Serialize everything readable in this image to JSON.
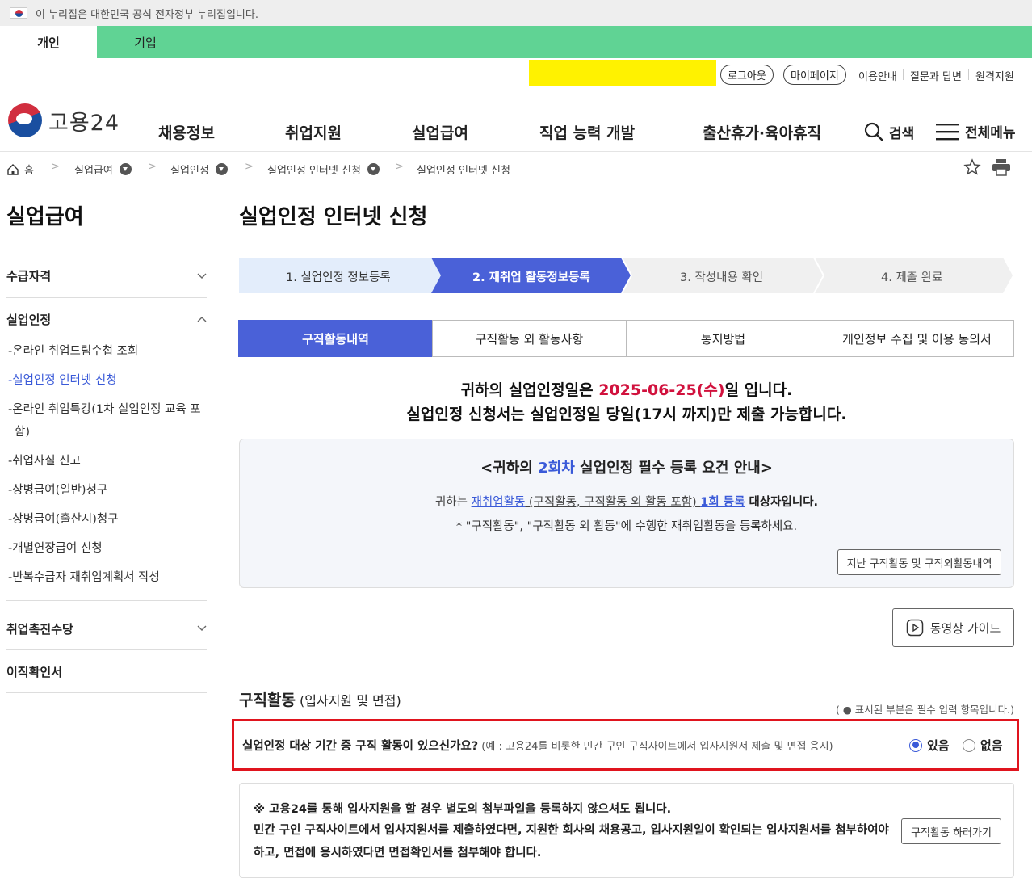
{
  "gov_banner": "이 누리집은 대한민국 공식 전자정부 누리집입니다.",
  "top_tabs": [
    "개인",
    "기업"
  ],
  "utility": {
    "logout": "로그아웃",
    "mypage": "마이페이지",
    "links": [
      "이용안내",
      "질문과 답변",
      "원격지원"
    ]
  },
  "logo_text": "고용24",
  "gnb": [
    "채용정보",
    "취업지원",
    "실업급여",
    "직업 능력 개발",
    "출산휴가·육아휴직"
  ],
  "search_label": "검색",
  "all_menu_label": "전체메뉴",
  "breadcrumb": [
    "홈",
    "실업급여",
    "실업인정",
    "실업인정 인터넷 신청",
    "실업인정 인터넷 신청"
  ],
  "lnb": {
    "title": "실업급여",
    "sections": [
      "수급자격",
      "실업인정",
      "취업촉진수당",
      "이직확인서"
    ],
    "sub_items": [
      "온라인 취업드림수첩 조회",
      "실업인정 인터넷 신청",
      "온라인 취업특강(1차 실업인정 교육 포함)",
      "취업사실 신고",
      "상병급여(일반)청구",
      "상병급여(출산시)청구",
      "개별연장급여 신청",
      "반복수급자 재취업계획서 작성"
    ]
  },
  "page_title": "실업인정 인터넷 신청",
  "steps": [
    "1. 실업인정 정보등록",
    "2. 재취업 활동정보등록",
    "3. 작성내용 확인",
    "4. 제출 완료"
  ],
  "content_tabs": [
    "구직활동내역",
    "구직활동 외 활동사항",
    "통지방법",
    "개인정보 수집 및 이용 동의서"
  ],
  "notice": {
    "line1_pre": "귀하의 실업인정일은 ",
    "date": "2025-06-25(수)",
    "line1_post": "일 입니다.",
    "line2": "실업인정 신청서는 실업인정일 당일(17시 까지)만 제출 가능합니다."
  },
  "req_box": {
    "title_pre": "<귀하의 ",
    "round": "2회차",
    "title_post": " 실업인정 필수 등록 요건 안내>",
    "l1_pre": "귀하는 ",
    "l1_link": "재취업활동",
    "l1_mid": " (구직활동, 구직활동 외 활동 포함) ",
    "l1_count": "1회 등록",
    "l1_post": " 대상자입니다.",
    "l2": "* \"구직활동\", \"구직활동 외 활동\"에 수행한 재취업활동을 등록하세요.",
    "history_button": "지난 구직활동 및 구직외활동내역"
  },
  "video_guide": "동영상 가이드",
  "section_title": "구직활동",
  "section_sub": " (입사지원 및 면접)",
  "required_note": "( ● 표시된 부분은 필수 입력 항목입니다.)",
  "question": "실업인정 대상 기간 중 구직 활동이 있으신가요?",
  "question_hint": " (예 : 고용24를 비롯한 민간 구인 구직사이트에서 입사지원서 제출 및 면접 응시)",
  "radio_yes": "있음",
  "radio_no": "없음",
  "info": {
    "t1": "※ 고용24를 통해 입사지원을 할 경우 별도의 첨부파일을 등록하지 않으셔도 됩니다.",
    "t2": "민간 구인 구직사이트에서 입사지원서를 제출하였다면, 지원한 회사의 채용공고, 입사지원일이 확인되는 입사지원서를 첨부하여야 하고, 면접에 응시하였다면 면접확인서를 첨부해야 합니다.",
    "button": "구직활동 하러가기"
  },
  "colors": {
    "accent": "#4a61d8",
    "green_bar": "#60d394",
    "highlight": "#d1113d",
    "redact": "#fff200"
  }
}
